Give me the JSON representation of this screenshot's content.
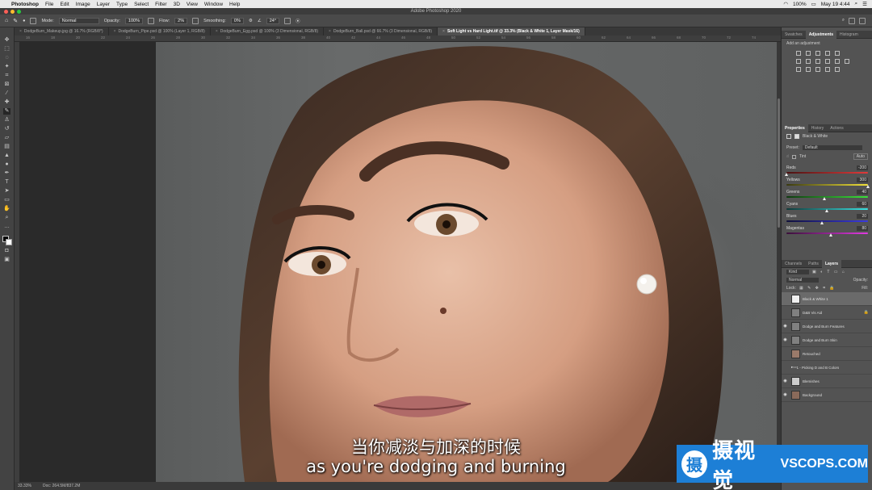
{
  "menubar": {
    "app": "Photoshop",
    "items": [
      "File",
      "Edit",
      "Image",
      "Layer",
      "Type",
      "Select",
      "Filter",
      "3D",
      "View",
      "Window",
      "Help"
    ],
    "battery": "100%",
    "clock": "May 19  4:44"
  },
  "window": {
    "title": "Adobe Photoshop 2020"
  },
  "options": {
    "mode_label": "Mode:",
    "mode_value": "Normal",
    "opacity_label": "Opacity:",
    "opacity_value": "100%",
    "flow_label": "Flow:",
    "flow_value": "2%",
    "smoothing_label": "Smoothing:",
    "smoothing_value": "0%",
    "angle_value": "24°"
  },
  "tabs": [
    "DodgeBurn_Makeup.jpg @ 16.7% (RGB/8*)",
    "DodgeBurn_Pipe.psd @ 100% (Layer 1, RGB/8)",
    "DodgeBurn_Egg.psd @ 100% (3 Dimensional, RGB/8)",
    "DodgeBurn_Ball.psd @ 66.7% (3 Dimensional, RGB/8)",
    "Soft Light vs Hard Light.tif @ 33.3% (Black & White 1, Layer Mask/16)"
  ],
  "ruler_ticks": [
    "16",
    "18",
    "20",
    "22",
    "24",
    "26",
    "28",
    "30",
    "32",
    "34",
    "36",
    "38",
    "40",
    "42",
    "44",
    "46",
    "48",
    "50",
    "52",
    "54",
    "56",
    "58",
    "60",
    "62",
    "64",
    "66",
    "68",
    "70",
    "72",
    "74"
  ],
  "status": {
    "zoom": "33.33%",
    "doc": "Doc: 264.5M/837.2M"
  },
  "adjustments": {
    "tabs": [
      "Swatches",
      "Adjustments",
      "Histogram"
    ],
    "active_tab": "Adjustments",
    "add_label": "Add an adjustment"
  },
  "properties": {
    "tabs": [
      "Properties",
      "History",
      "Actions"
    ],
    "active_tab": "Properties",
    "title": "Black & White",
    "preset_label": "Preset:",
    "preset_value": "Default",
    "tint_label": "Tint",
    "auto_label": "Auto",
    "sliders": [
      {
        "label": "Reds",
        "value": "-200",
        "pos": 0.0,
        "grad": "linear-gradient(90deg,#4a1212,#e23a3a)"
      },
      {
        "label": "Yellows",
        "value": "300",
        "pos": 1.0,
        "grad": "linear-gradient(90deg,#3a3a10,#f2e23a)"
      },
      {
        "label": "Greens",
        "value": "40",
        "pos": 0.47,
        "grad": "linear-gradient(90deg,#0f3a10,#3ae23a)"
      },
      {
        "label": "Cyans",
        "value": "60",
        "pos": 0.5,
        "grad": "linear-gradient(90deg,#0f3a3a,#3ae2e2)"
      },
      {
        "label": "Blues",
        "value": "20",
        "pos": 0.44,
        "grad": "linear-gradient(90deg,#10103a,#3a3ae2)"
      },
      {
        "label": "Magentas",
        "value": "80",
        "pos": 0.55,
        "grad": "linear-gradient(90deg,#3a103a,#e23ae2)"
      }
    ]
  },
  "layers": {
    "tabs": [
      "Channels",
      "Paths",
      "Layers"
    ],
    "active_tab": "Layers",
    "filter_label": "Kind",
    "mode_value": "Normal",
    "opacity_label": "Opacity:",
    "lock_label": "Lock:",
    "fill_label": "Fill:",
    "items": [
      {
        "name": "Black & White 1",
        "visible": false,
        "selected": true,
        "thumb": "#f0f0f0"
      },
      {
        "name": "D&B Vis Aid",
        "visible": false,
        "selected": false,
        "thumb": "#808080",
        "locked": true
      },
      {
        "name": "Dodge and Burn Features",
        "visible": true,
        "selected": false,
        "thumb": "#808080"
      },
      {
        "name": "Dodge and Burn Skin",
        "visible": true,
        "selected": false,
        "thumb": "#808080"
      },
      {
        "name": "Retouched",
        "visible": false,
        "selected": false,
        "thumb": "#9a7a6a"
      },
      {
        "name": "1 - Picking D and B Colors",
        "visible": false,
        "selected": false,
        "thumb": "#6a6a6a",
        "folder": true
      },
      {
        "name": "Blemishes",
        "visible": true,
        "selected": false,
        "thumb": "#cccccc"
      },
      {
        "name": "Background",
        "visible": true,
        "selected": false,
        "thumb": "#8a6a5a"
      }
    ]
  },
  "subtitles": {
    "cn": "当你减淡与加深的时候",
    "en": "as you're dodging and burning"
  },
  "watermark": {
    "cn": "摄视觉",
    "en": "VSCOPS.COM",
    "logo": "摄"
  }
}
